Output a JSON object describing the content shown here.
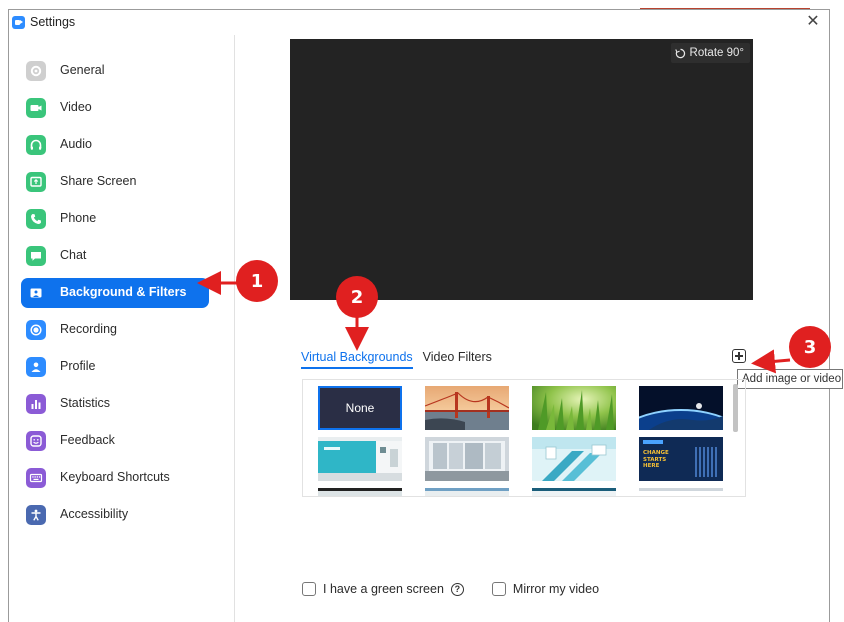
{
  "window": {
    "title": "Settings",
    "close_glyph": "✕"
  },
  "sidebar": {
    "items": [
      {
        "label": "General",
        "icon": "gear-icon",
        "color": "#cfcfcf"
      },
      {
        "label": "Video",
        "icon": "video-camera-icon",
        "color": "#3ac57b"
      },
      {
        "label": "Audio",
        "icon": "headphones-icon",
        "color": "#3ac57b"
      },
      {
        "label": "Share Screen",
        "icon": "share-screen-icon",
        "color": "#3ac57b"
      },
      {
        "label": "Phone",
        "icon": "phone-icon",
        "color": "#3ac57b"
      },
      {
        "label": "Chat",
        "icon": "chat-bubble-icon",
        "color": "#3ac57b"
      },
      {
        "label": "Background & Filters",
        "icon": "background-icon",
        "color": "#0e72ed",
        "active": true
      },
      {
        "label": "Recording",
        "icon": "record-icon",
        "color": "#2d8cff"
      },
      {
        "label": "Profile",
        "icon": "user-icon",
        "color": "#2d8cff"
      },
      {
        "label": "Statistics",
        "icon": "bar-chart-icon",
        "color": "#8b5bd6"
      },
      {
        "label": "Feedback",
        "icon": "smiley-icon",
        "color": "#8b5bd6"
      },
      {
        "label": "Keyboard Shortcuts",
        "icon": "keyboard-icon",
        "color": "#8b5bd6"
      },
      {
        "label": "Accessibility",
        "icon": "accessibility-icon",
        "color": "#4a69b0"
      }
    ]
  },
  "preview": {
    "rotate_label": "Rotate 90°"
  },
  "tabs": [
    {
      "label": "Virtual Backgrounds",
      "active": true
    },
    {
      "label": "Video Filters",
      "active": false
    }
  ],
  "add_button": {
    "tooltip": "Add image or video"
  },
  "gallery": {
    "none_label": "None",
    "thumbnails": [
      "none",
      "golden-gate-bridge",
      "grass",
      "earth-from-space",
      "teal-office",
      "glass-room",
      "escalator",
      "change-starts-here-banner"
    ],
    "banner_text": "CHANGE STARTS HERE"
  },
  "options": {
    "green_screen_label": "I have a green screen",
    "mirror_label": "Mirror my video"
  },
  "annotations": [
    "1",
    "2",
    "3"
  ],
  "colors": {
    "accent": "#0e72ed",
    "annotation": "#e02020",
    "preview_bg": "#232323"
  }
}
